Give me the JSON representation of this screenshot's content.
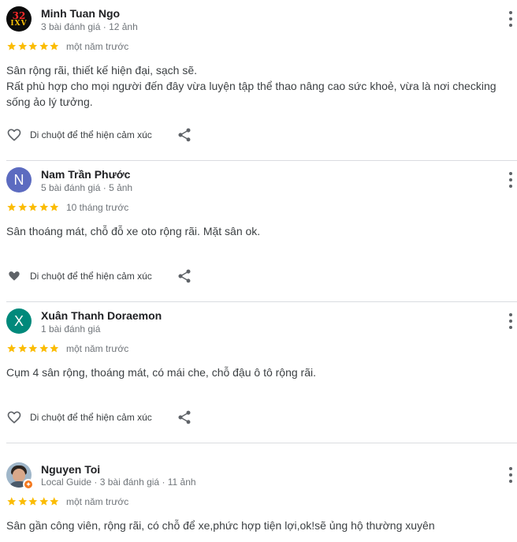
{
  "reviews": [
    {
      "name": "Minh Tuan Ngo",
      "meta": "3 bài đánh giá · 12 ảnh",
      "avatar": {
        "type": "logo",
        "line1": "32",
        "line2": "IXV"
      },
      "rating": 5,
      "time": "một năm trước",
      "text_lines": [
        "Sân rộng rãi, thiết kế hiện đại, sạch sẽ.",
        "Rất phù hợp cho mọi người đến đây vừa luyện tập thể thao nâng cao sức khoẻ, vừa là nơi checking",
        "sống ảo lý tưởng."
      ],
      "reaction_label": "Di chuột để thể hiện cảm xúc"
    },
    {
      "name": "Nam Trần Phước",
      "meta": "5 bài đánh giá · 5 ảnh",
      "avatar": {
        "type": "letter",
        "letter": "N",
        "color": "#5c6bc0"
      },
      "rating": 5,
      "time": "10 tháng trước",
      "text_lines": [
        "Sân thoáng mát, chỗ đỗ xe oto rộng rãi. Mặt sân ok."
      ],
      "reaction_label": "Di chuột để thể hiện cảm xúc"
    },
    {
      "name": "Xuân Thanh Doraemon",
      "meta": "1 bài đánh giá",
      "avatar": {
        "type": "letter",
        "letter": "X",
        "color": "#00897b"
      },
      "rating": 5,
      "time": "một năm trước",
      "text_lines": [
        "Cụm 4 sân rộng, thoáng mát, có mái che, chỗ đậu ô tô rộng rãi."
      ],
      "reaction_label": "Di chuột để thể hiện cảm xúc"
    },
    {
      "name": "Nguyen Toi",
      "meta": "Local Guide · 3 bài đánh giá · 11 ảnh",
      "avatar": {
        "type": "photo",
        "badge_color": "#f4791f"
      },
      "rating": 5,
      "time": "một năm trước",
      "text_lines": [
        "Sân gần công viên, rộng rãi, có chỗ để xe,phức hợp tiện lợi,ok!sẽ ủng hộ thường xuyên"
      ]
    }
  ],
  "colors": {
    "star": "#fbbc04",
    "icon": "#5f6368",
    "divider": "#dadce0"
  },
  "icons": {
    "reaction": "heart-outline-icon",
    "share": "share-icon",
    "more": "more-vert-icon"
  }
}
